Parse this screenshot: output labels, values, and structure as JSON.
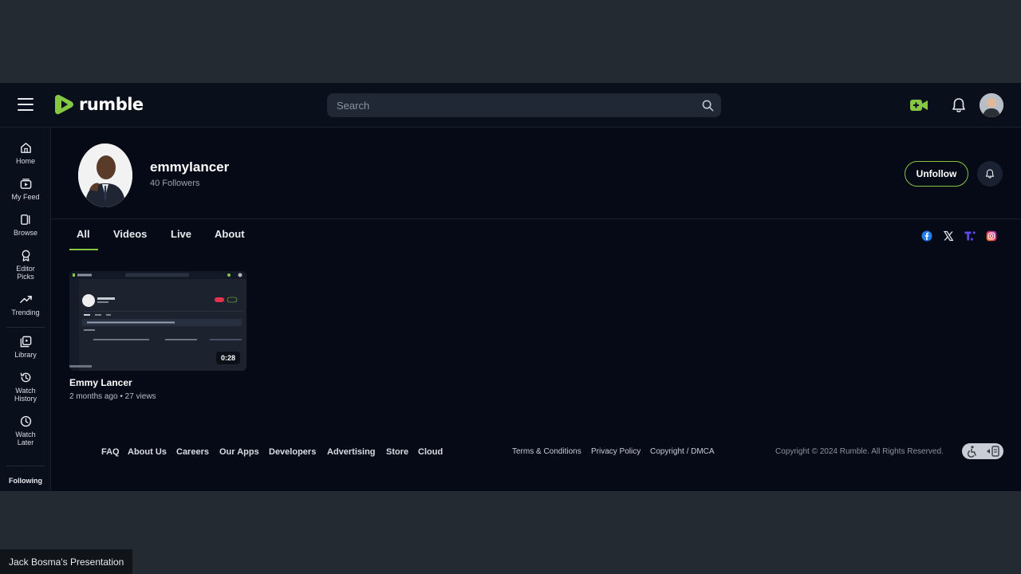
{
  "header": {
    "logo_text": "rumble",
    "search_placeholder": "Search"
  },
  "sidebar": {
    "items": [
      {
        "label": "Home",
        "icon": "home-icon"
      },
      {
        "label": "My Feed",
        "icon": "feed-icon"
      },
      {
        "label": "Browse",
        "icon": "browse-icon"
      },
      {
        "label": "Editor Picks",
        "icon": "award-icon"
      },
      {
        "label": "Trending",
        "icon": "trending-icon"
      },
      {
        "label": "Library",
        "icon": "library-icon"
      },
      {
        "label": "Watch History",
        "icon": "history-icon"
      },
      {
        "label": "Watch Later",
        "icon": "clock-icon"
      }
    ],
    "following_label": "Following"
  },
  "channel": {
    "name": "emmylancer",
    "followers": "40 Followers",
    "unfollow_label": "Unfollow"
  },
  "tabs": [
    {
      "label": "All",
      "active": true
    },
    {
      "label": "Videos",
      "active": false
    },
    {
      "label": "Live",
      "active": false
    },
    {
      "label": "About",
      "active": false
    }
  ],
  "social_icons": [
    "facebook-icon",
    "x-icon",
    "truth-social-icon",
    "instagram-icon"
  ],
  "videos": [
    {
      "title": "Emmy Lancer",
      "meta": "2 months ago • 27 views",
      "duration": "0:28"
    }
  ],
  "footer": {
    "links": [
      "FAQ",
      "About Us",
      "Careers",
      "Our Apps",
      "Developers",
      "Advertising",
      "Store",
      "Cloud"
    ],
    "legal": [
      "Terms & Conditions",
      "Privacy Policy",
      "Copyright / DMCA"
    ],
    "copyright": "Copyright © 2024 Rumble. All Rights Reserved."
  },
  "presenter_label": "Jack Bosma's Presentation",
  "colors": {
    "accent": "#85c742",
    "background": "#060a17",
    "header": "#0a0f1c",
    "outer": "#242a31"
  }
}
